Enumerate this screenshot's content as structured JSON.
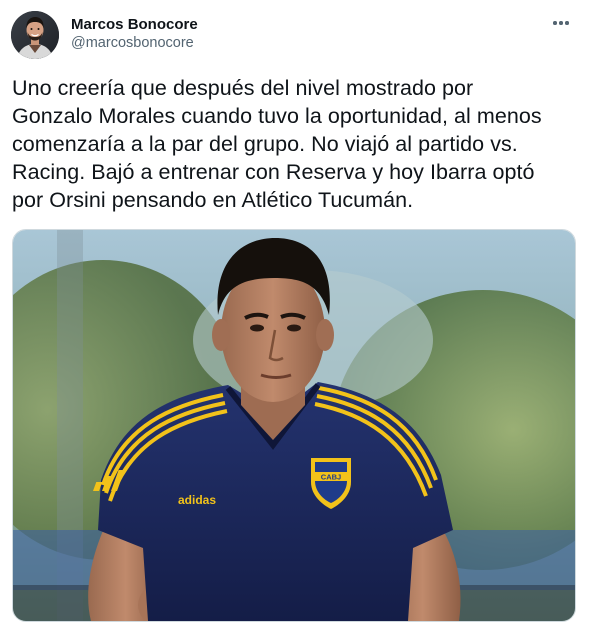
{
  "author": {
    "display_name": "Marcos Bonocore",
    "handle": "@marcosbonocore"
  },
  "tweet": {
    "text": "Uno creería que después del nivel mostrado por\nGonzalo Morales cuando tuvo la oportunidad, al menos\ncomenzaría a la par del grupo. No viajó al partido vs.\nRacing. Bajó a entrenar con Reserva y hoy Ibarra optó\npor Orsini pensando en Atlético Tucumán."
  },
  "photo": {
    "kit_brand": "adidas",
    "crest_text": "CABJ"
  },
  "icons": {
    "more": "more-horizontal-icon",
    "avatar": "profile-avatar"
  },
  "colors": {
    "text": "#0f1419",
    "secondary": "#536471",
    "border": "#cfd9de",
    "jersey_navy": "#1c2a63",
    "jersey_gold": "#f2c21a"
  }
}
